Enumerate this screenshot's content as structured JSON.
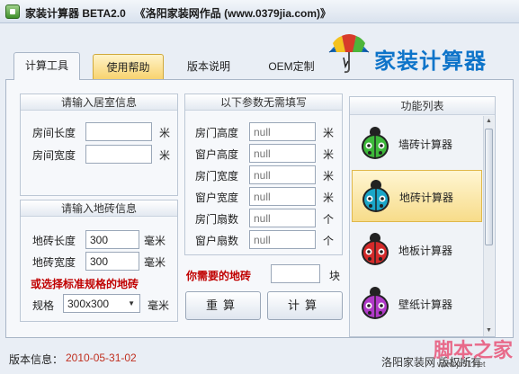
{
  "window": {
    "title": "家装计算器 BETA2.0   《洛阳家装网作品 (www.0379jia.com)》"
  },
  "logo": {
    "text": "家装计算器"
  },
  "tabs": [
    {
      "label": "计算工具"
    },
    {
      "label": "使用帮助"
    },
    {
      "label": "版本说明"
    },
    {
      "label": "OEM定制"
    }
  ],
  "room": {
    "title": "请输入居室信息",
    "length_label": "房间长度",
    "length_value": "",
    "length_unit": "米",
    "width_label": "房间宽度",
    "width_value": "",
    "width_unit": "米"
  },
  "tile": {
    "title": "请输入地砖信息",
    "length_label": "地砖长度",
    "length_value": "300",
    "length_unit": "毫米",
    "width_label": "地砖宽度",
    "width_value": "300",
    "width_unit": "毫米",
    "standard_hint": "或选择标准规格的地砖",
    "spec_label": "规格",
    "spec_value": "300x300",
    "spec_unit": "毫米"
  },
  "optional": {
    "title": "以下参数无需填写",
    "rows": [
      {
        "label": "房门高度",
        "placeholder": "null",
        "unit": "米"
      },
      {
        "label": "窗户高度",
        "placeholder": "null",
        "unit": "米"
      },
      {
        "label": "房门宽度",
        "placeholder": "null",
        "unit": "米"
      },
      {
        "label": "窗户宽度",
        "placeholder": "null",
        "unit": "米"
      },
      {
        "label": "房门扇数",
        "placeholder": "null",
        "unit": "个"
      },
      {
        "label": "窗户扇数",
        "placeholder": "null",
        "unit": "个"
      }
    ]
  },
  "result": {
    "label": "你需要的地砖",
    "value": "",
    "unit": "块"
  },
  "buttons": {
    "reset": "重算",
    "calculate": "计算"
  },
  "function_list": {
    "title": "功能列表",
    "items": [
      {
        "label": "墙砖计算器",
        "color": "#3db83a"
      },
      {
        "label": "地砖计算器",
        "color": "#1aa6c8"
      },
      {
        "label": "地板计算器",
        "color": "#d42a2a"
      },
      {
        "label": "壁纸计算器",
        "color": "#b03ac8"
      }
    ]
  },
  "status": {
    "version_label": "版本信息：",
    "version_value": "2010-05-31-02",
    "copyright": "洛阳家装网 版权所有"
  },
  "watermark": {
    "big": "脚本之家",
    "small": "www.jb51.net"
  }
}
